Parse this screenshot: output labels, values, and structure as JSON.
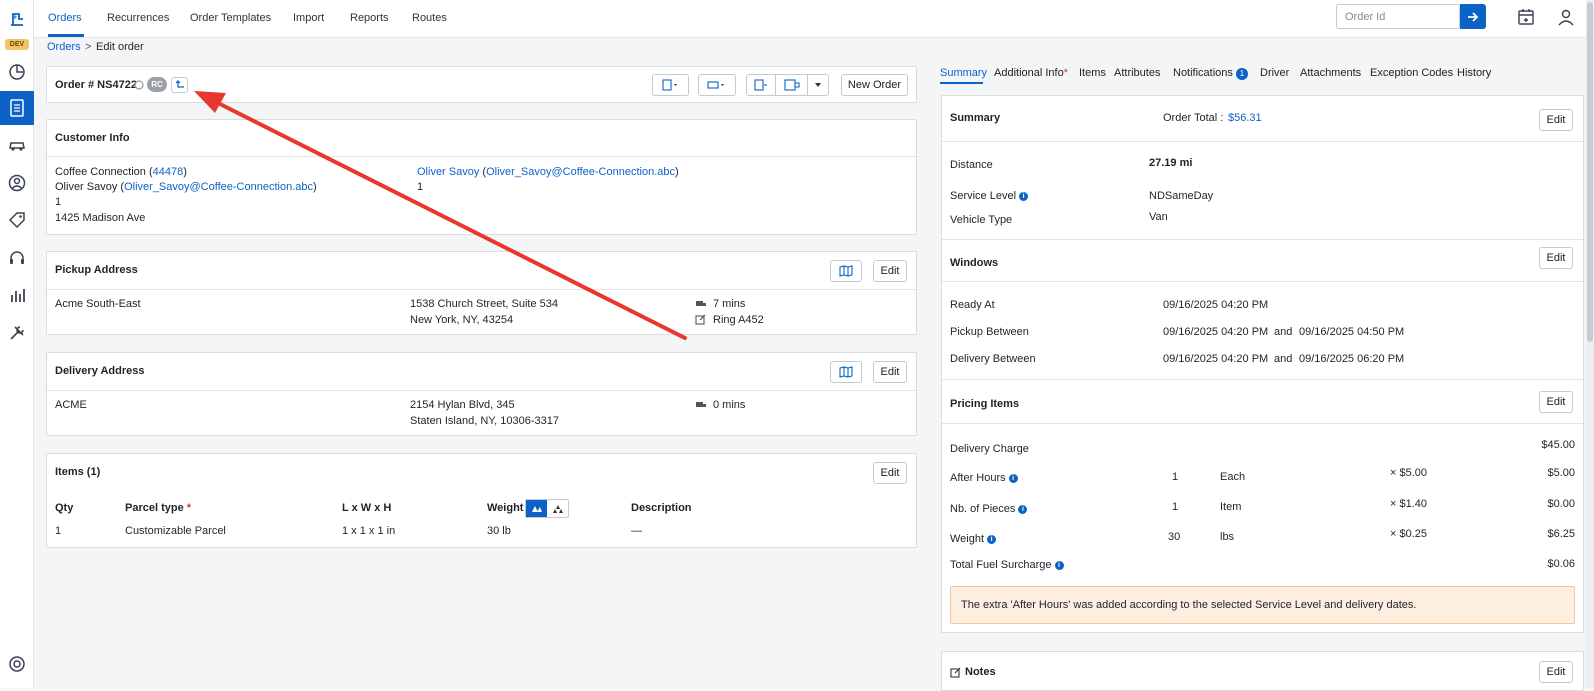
{
  "sidebar": {
    "dev_badge": "DEV"
  },
  "nav": {
    "tabs": [
      "Orders",
      "Recurrences",
      "Order Templates",
      "Import",
      "Reports",
      "Routes"
    ]
  },
  "search": {
    "placeholder": "Order Id"
  },
  "breadcrumb": {
    "root": "Orders",
    "sep": ">",
    "current": "Edit order"
  },
  "order": {
    "title": "Order # NS4722",
    "rc_badge": "RC",
    "new_order_label": "New Order"
  },
  "customer": {
    "header": "Customer Info",
    "company": "Coffee Connection",
    "company_id": "44478",
    "contact_name": "Oliver Savoy",
    "contact_email": "Oliver_Savoy@Coffee-Connection.abc",
    "line3": "1",
    "address": "1425 Madison Ave",
    "right_name": "Oliver Savoy",
    "right_email": "Oliver_Savoy@Coffee-Connection.abc",
    "right_line2": "1"
  },
  "pickup": {
    "header": "Pickup Address",
    "name": "Acme South-East",
    "address1": "1538 Church Street, Suite 534",
    "address2": "New York, NY, 43254",
    "wait": "7 mins",
    "note": "Ring A452",
    "edit": "Edit"
  },
  "delivery": {
    "header": "Delivery Address",
    "name": "ACME",
    "address1": "2154 Hylan Blvd, 345",
    "address2": "Staten Island, NY, 10306-3317",
    "wait": "0 mins",
    "edit": "Edit"
  },
  "items": {
    "header": "Items (1)",
    "edit": "Edit",
    "columns": [
      "Qty",
      "Parcel type",
      "L x W x H",
      "Weight",
      "Description"
    ],
    "rows": [
      {
        "qty": "1",
        "type": "Customizable Parcel",
        "dims": "1 x 1 x 1 in",
        "weight": "30 lb",
        "desc": "—"
      }
    ]
  },
  "right_tabs": [
    "Summary",
    "Additional Info",
    "Items",
    "Attributes",
    "Notifications",
    "Driver",
    "Attachments",
    "Exception Codes",
    "History"
  ],
  "notif_count": "1",
  "summary": {
    "header": "Summary",
    "total_label": "Order Total :",
    "total": "$56.31",
    "edit": "Edit",
    "distance_label": "Distance",
    "distance": "27.19 mi",
    "service_label": "Service Level",
    "service": "NDSameDay",
    "vehicle_label": "Vehicle Type",
    "vehicle": "Van"
  },
  "windows": {
    "header": "Windows",
    "edit": "Edit",
    "ready_label": "Ready At",
    "ready": "09/16/2025 04:20 PM",
    "pickup_label": "Pickup Between",
    "pickup_from": "09/16/2025 04:20 PM",
    "pickup_to": "09/16/2025 04:50 PM",
    "delivery_label": "Delivery Between",
    "delivery_from": "09/16/2025 04:20 PM",
    "delivery_to": "09/16/2025 06:20 PM",
    "and": "and"
  },
  "pricing": {
    "header": "Pricing Items",
    "edit": "Edit",
    "delivery_charge_label": "Delivery Charge",
    "delivery_charge": "$45.00",
    "rows": [
      {
        "label": "After Hours",
        "qty": "1",
        "unit": "Each",
        "rate": "× $5.00",
        "amount": "$5.00"
      },
      {
        "label": "Nb. of Pieces",
        "qty": "1",
        "unit": "Item",
        "rate": "× $1.40",
        "amount": "$0.00"
      },
      {
        "label": "Weight",
        "qty": "30",
        "unit": "lbs",
        "rate": "× $0.25",
        "amount": "$6.25"
      }
    ],
    "fuel_label": "Total Fuel Surcharge",
    "fuel": "$0.06",
    "notice": "The extra 'After Hours' was added according to the selected Service Level and delivery dates."
  },
  "notes": {
    "header": "Notes",
    "edit": "Edit"
  },
  "colors": {
    "accent": "#0d62c7",
    "arrow": "#e8382d",
    "notice_bg": "#fdefdf"
  }
}
